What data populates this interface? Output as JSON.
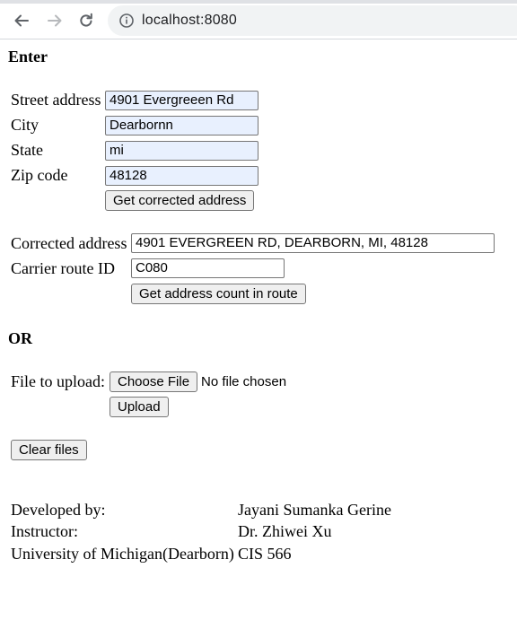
{
  "browser": {
    "url": "localhost:8080",
    "icons": [
      "back-arrow-icon",
      "forward-arrow-icon",
      "reload-icon",
      "site-info-icon"
    ]
  },
  "form": {
    "heading": "Enter",
    "street_label": "Street address",
    "street_value": "4901 Evergreeen Rd",
    "city_label": "City",
    "city_value": "Dearbornn",
    "state_label": "State",
    "state_value": "mi",
    "zip_label": "Zip code",
    "zip_value": "48128",
    "submit_label": "Get corrected address"
  },
  "result": {
    "corrected_label": "Corrected address",
    "corrected_value": "4901 EVERGREEN RD, DEARBORN, MI, 48128",
    "route_label": "Carrier route ID",
    "route_value": "C080",
    "count_button": "Get address count in route"
  },
  "upload": {
    "heading": "OR",
    "file_label": "File to upload:",
    "choose_button": "Choose File",
    "no_file_text": "No file chosen",
    "upload_button": "Upload",
    "clear_button": "Clear files"
  },
  "footer": {
    "developed_label": "Developed by:",
    "developed_value": "Jayani Sumanka Gerine",
    "instructor_label": "Instructor:",
    "instructor_value": "Dr. Zhiwei Xu",
    "university_label": "University of Michigan(Dearborn)",
    "course_value": "CIS 566"
  }
}
